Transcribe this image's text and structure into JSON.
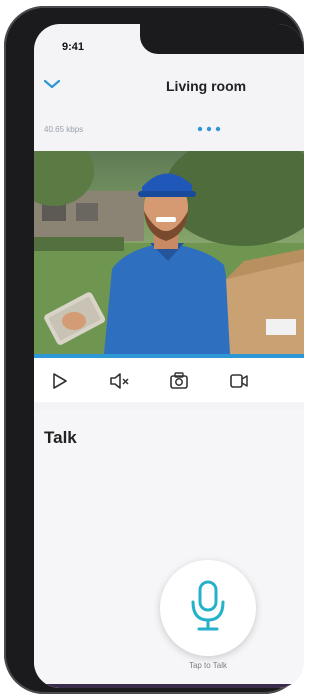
{
  "status_bar": {
    "time": "9:41"
  },
  "header": {
    "title": "Living room",
    "back_icon": "chevron-down-icon",
    "more_icon": "more-dots-icon"
  },
  "stream": {
    "bitrate": "40.65 kbps"
  },
  "controls": [
    {
      "name": "play-icon"
    },
    {
      "name": "mute-icon"
    },
    {
      "name": "snapshot-icon"
    },
    {
      "name": "record-icon"
    }
  ],
  "talk": {
    "label": "Talk",
    "tap_label": "Tap to Talk"
  },
  "colors": {
    "accent": "#2e98d6",
    "mic": "#25b1c9"
  }
}
